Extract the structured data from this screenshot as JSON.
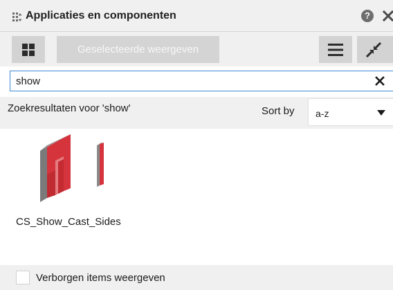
{
  "panel": {
    "title": "Applicaties en componenten",
    "help_icon": "help-icon",
    "help_symbol": "?",
    "close_icon": "close-icon"
  },
  "toolbar": {
    "grid_icon": "grid-view-icon",
    "show_selected_label": "Geselecteerde weergeven",
    "list_icon": "list-view-icon",
    "collapse_icon": "collapse-icon"
  },
  "search": {
    "value": "show",
    "clear_icon": "clear-icon"
  },
  "results": {
    "label": "Zoekresultaten voor 'show'",
    "sort_label": "Sort by",
    "sort_value": "a-z",
    "items": [
      {
        "name": "CS_Show_Cast_Sides",
        "thumbnail_icon": "component-thumbnail-icon"
      }
    ]
  },
  "footer": {
    "checkbox_label": "Verborgen items weergeven",
    "checked": false
  },
  "colors": {
    "panel_bg": "#f0f0f0",
    "button_bg": "#d3d3d3",
    "focus_border": "#3a88d4",
    "thumbnail_red": "#d6343c"
  }
}
